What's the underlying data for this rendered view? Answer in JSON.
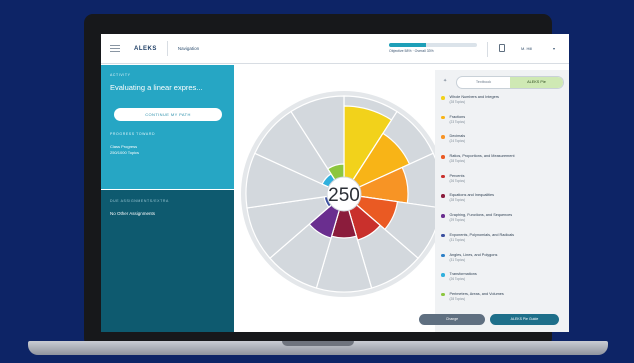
{
  "app": {
    "brand": "ALEKS",
    "nav_title": "Navigation",
    "progress_text": "Objective 58% · Overall 33%",
    "progress_fraction": 0.42,
    "user_name": "M. Hill",
    "caret": "▾"
  },
  "sidebar": {
    "activity_label": "ACTIVITY",
    "topic_title": "Evaluating a linear expres...",
    "continue_label": "CONTINUE MY PATH",
    "progress_label": "PROGRESS TOWARD",
    "progress_line1": "Class Progress",
    "progress_line2": "250/1000 Topics",
    "assignments_label": "DUE ASSIGNMENTS/EXTRA",
    "no_assignments": "No Other Assignments"
  },
  "wheel": {
    "center_value": "250"
  },
  "toggle": {
    "left_label": "Textbook",
    "right_label": "ALEKS Pie",
    "active": "right"
  },
  "legend": {
    "items": [
      {
        "name": "Whole Numbers and Integers",
        "count": "(28 Topics)",
        "color": "#f2d21b"
      },
      {
        "name": "Fractions",
        "count": "(23 Topics)",
        "color": "#f8b417"
      },
      {
        "name": "Decimals",
        "count": "(24 Topics)",
        "color": "#f79425"
      },
      {
        "name": "Ratios, Proportions, and Measurement",
        "count": "(28 Topics)",
        "color": "#ea5a23"
      },
      {
        "name": "Percents",
        "count": "(26 Topics)",
        "color": "#c9302c"
      },
      {
        "name": "Equations and Inequalities",
        "count": "(28 Topics)",
        "color": "#8b1c3c"
      },
      {
        "name": "Graphing, Functions, and Sequences",
        "count": "(29 Topics)",
        "color": "#6a2e8f"
      },
      {
        "name": "Exponents, Polynomials, and Radicals",
        "count": "(31 Topics)",
        "color": "#3a4f9f"
      },
      {
        "name": "Angles, Lines, and Polygons",
        "count": "(31 Topics)",
        "color": "#2b7fc7"
      },
      {
        "name": "Transformations",
        "count": "(26 Topics)",
        "color": "#30b0dd"
      },
      {
        "name": "Perimeters, Areas, and Volumes",
        "count": "(28 Topics)",
        "color": "#8cc63f"
      }
    ]
  },
  "footer": {
    "change_label": "Change",
    "read_label": "ALEKS Pie Guide"
  }
}
